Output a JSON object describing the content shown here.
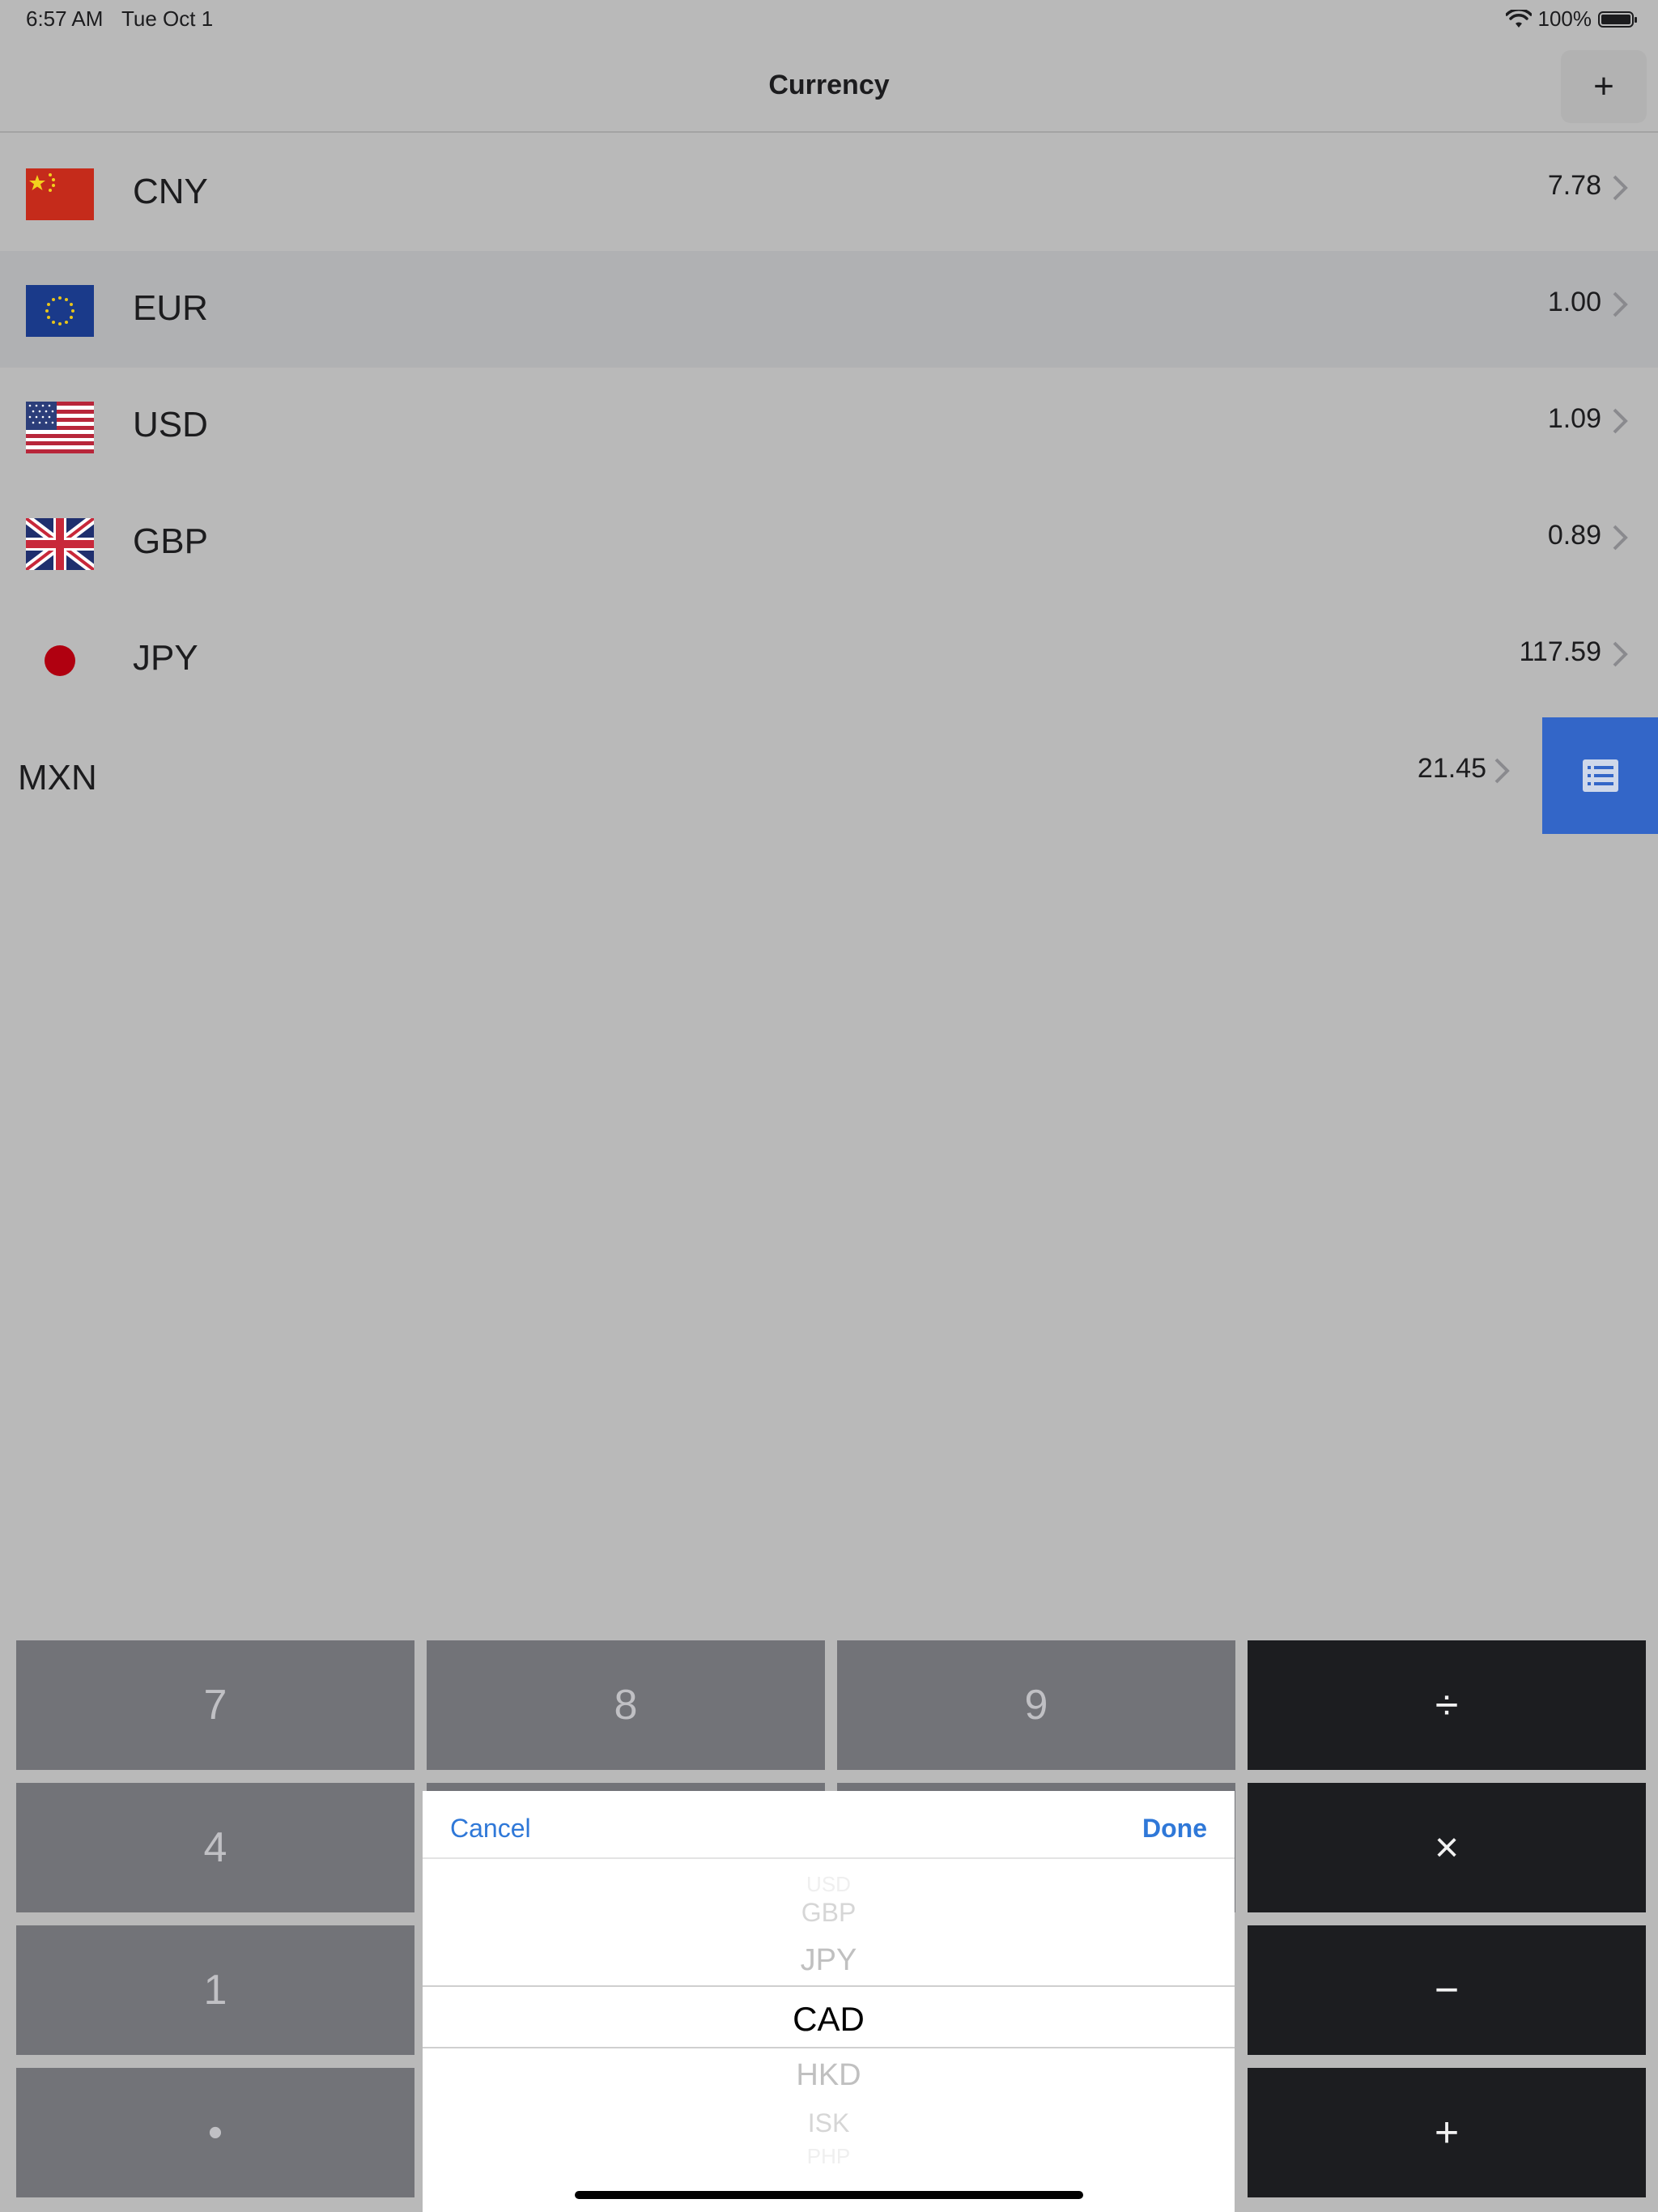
{
  "status": {
    "time": "6:57 AM",
    "date": "Tue Oct 1",
    "battery": "100%"
  },
  "nav": {
    "title": "Currency",
    "add_label": "+"
  },
  "rows": [
    {
      "code": "CNY",
      "value": "7.78",
      "flag": "china-flag"
    },
    {
      "code": "EUR",
      "value": "1.00",
      "flag": "eu-flag"
    },
    {
      "code": "USD",
      "value": "1.09",
      "flag": "us-flag"
    },
    {
      "code": "GBP",
      "value": "0.89",
      "flag": "uk-flag"
    },
    {
      "code": "JPY",
      "value": "117.59",
      "flag": "japan-flag"
    },
    {
      "code": "MXN",
      "value": "21.45"
    }
  ],
  "keypad": {
    "k7": "7",
    "k8": "8",
    "k9": "9",
    "div": "÷",
    "k4": "4",
    "mul": "×",
    "k1": "1",
    "minus": "−",
    "dot": "•",
    "plus": "+"
  },
  "picker": {
    "cancel": "Cancel",
    "done": "Done",
    "items": [
      "USD",
      "GBP",
      "JPY",
      "CAD",
      "HKD",
      "ISK",
      "PHP"
    ],
    "selected": "CAD"
  },
  "colors": {
    "accent": "#2f78d8",
    "list_button": "#3366c8"
  }
}
